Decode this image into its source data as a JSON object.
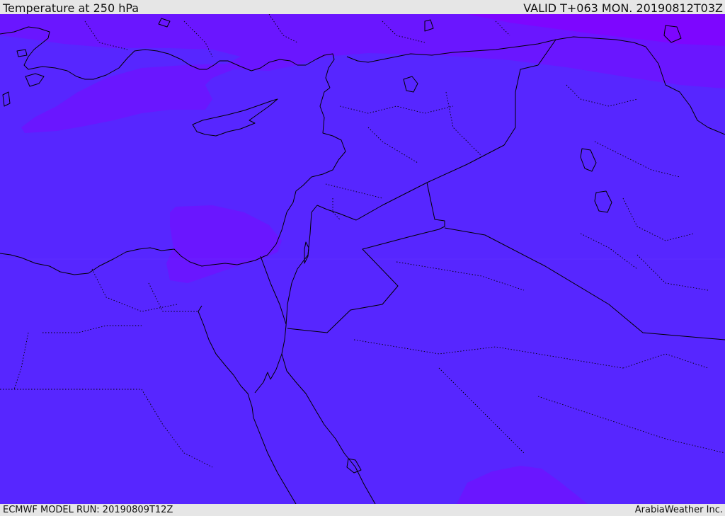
{
  "header": {
    "title": "Temperature at 250 hPa",
    "valid": "VALID T+063 MON. 20190812T03Z"
  },
  "footer": {
    "model_run": "ECMWF MODEL RUN: 20190809T12Z",
    "credit": "ArabiaWeather Inc."
  },
  "map": {
    "base_fill_color": "#5726ff",
    "warm_band_color": "#6a16ff",
    "warmest_band_color": "#7d06ff",
    "coastline_color": "#000000",
    "border_style": "dotted"
  }
}
